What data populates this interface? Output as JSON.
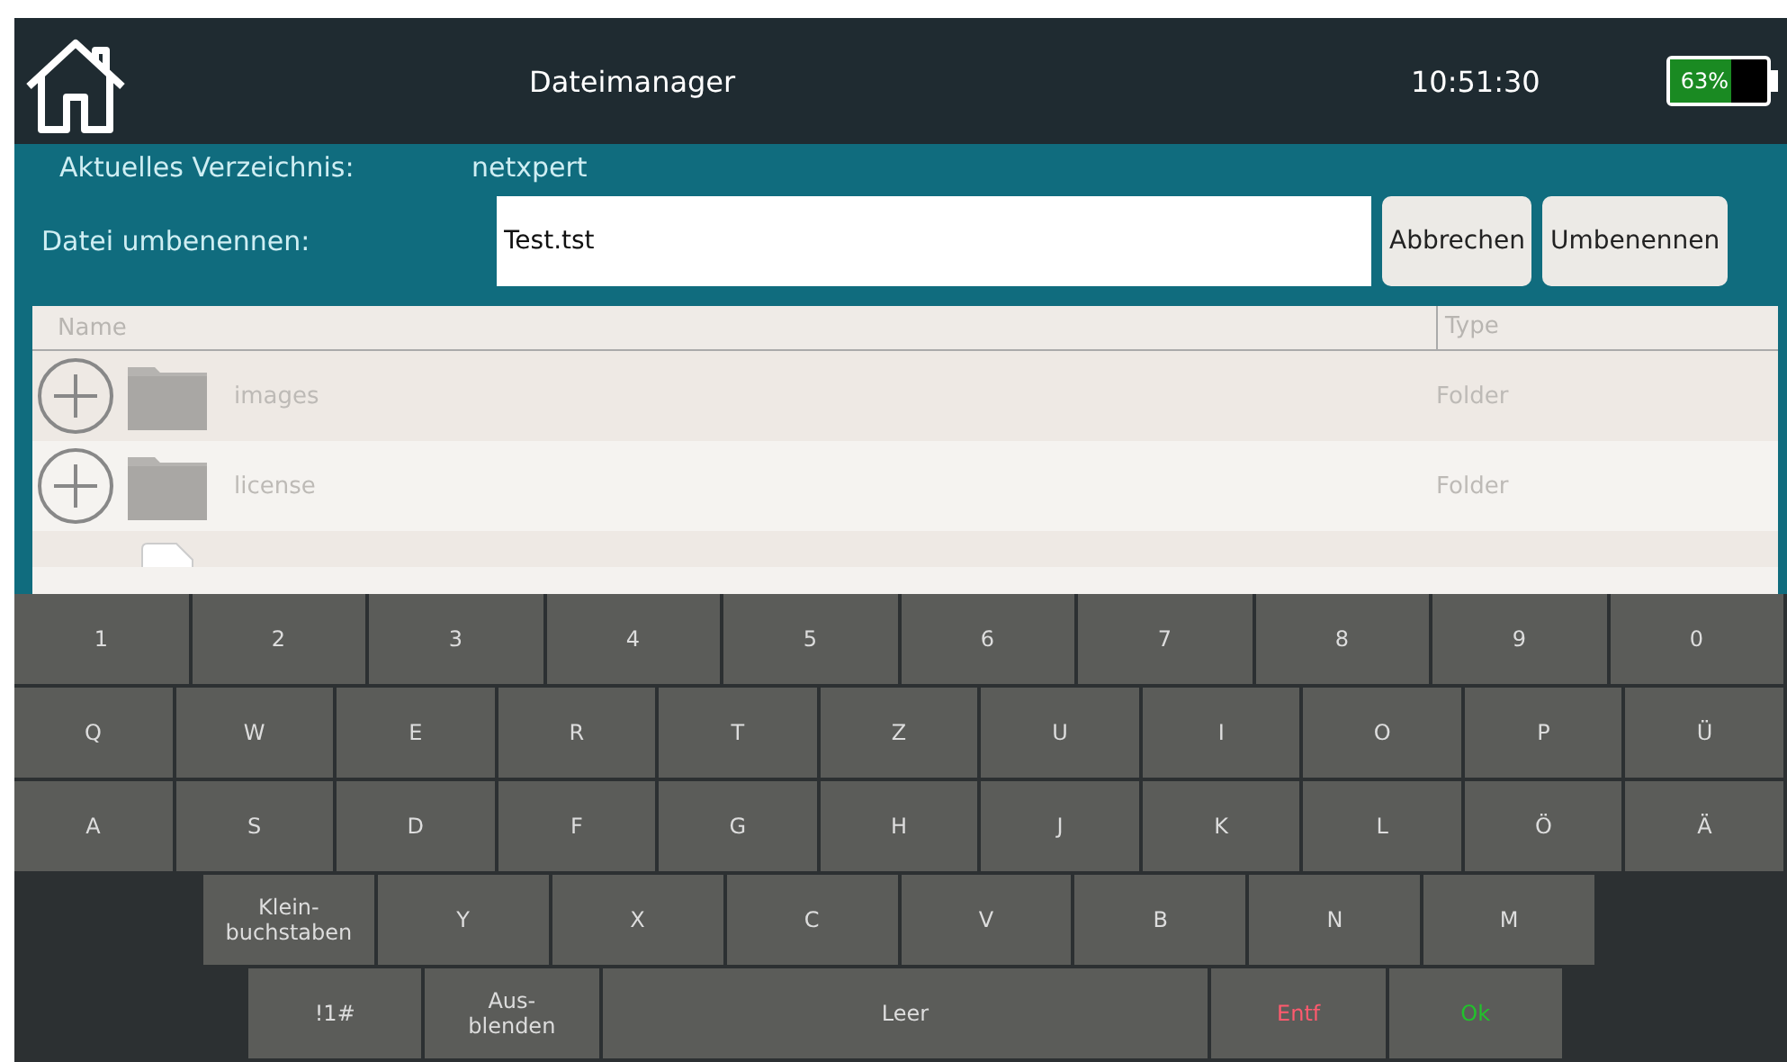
{
  "header": {
    "title": "Dateimanager",
    "time": "10:51:30",
    "battery": {
      "level": 0.63,
      "label": "63%"
    }
  },
  "current_directory": {
    "label": "Aktuelles Verzeichnis:",
    "value": "netxpert"
  },
  "rename": {
    "label": "Datei umbenennen:",
    "value": "Test.tst",
    "buttons": [
      "Abbrechen",
      "Umbenennen"
    ]
  },
  "table": {
    "columns": [
      "Name",
      "Type"
    ],
    "rows": [
      {
        "kind": "folder",
        "name": "images",
        "type": "Folder",
        "expanded": false
      },
      {
        "kind": "folder",
        "name": "license",
        "type": "Folder",
        "expanded": false
      },
      {
        "kind": "file"
      }
    ]
  },
  "keyboard": {
    "rows": [
      {
        "keys": [
          {
            "label": "1",
            "kind": "normal"
          },
          {
            "label": "2",
            "kind": "normal"
          },
          {
            "label": "3",
            "kind": "normal"
          },
          {
            "label": "4",
            "kind": "normal"
          },
          {
            "label": "5",
            "kind": "normal"
          },
          {
            "label": "6",
            "kind": "normal"
          },
          {
            "label": "7",
            "kind": "normal"
          },
          {
            "label": "8",
            "kind": "normal"
          },
          {
            "label": "9",
            "kind": "normal"
          },
          {
            "label": "0",
            "kind": "normal"
          }
        ]
      },
      {
        "keys": [
          {
            "label": "Q",
            "kind": "normal"
          },
          {
            "label": "W",
            "kind": "normal"
          },
          {
            "label": "E",
            "kind": "normal"
          },
          {
            "label": "R",
            "kind": "normal"
          },
          {
            "label": "T",
            "kind": "normal"
          },
          {
            "label": "Z",
            "kind": "normal"
          },
          {
            "label": "U",
            "kind": "normal"
          },
          {
            "label": "I",
            "kind": "normal"
          },
          {
            "label": "O",
            "kind": "normal"
          },
          {
            "label": "P",
            "kind": "normal"
          },
          {
            "label": "Ü",
            "kind": "normal"
          }
        ]
      },
      {
        "keys": [
          {
            "label": "A",
            "kind": "normal"
          },
          {
            "label": "S",
            "kind": "normal"
          },
          {
            "label": "D",
            "kind": "normal"
          },
          {
            "label": "F",
            "kind": "normal"
          },
          {
            "label": "G",
            "kind": "normal"
          },
          {
            "label": "H",
            "kind": "normal"
          },
          {
            "label": "J",
            "kind": "normal"
          },
          {
            "label": "K",
            "kind": "normal"
          },
          {
            "label": "L",
            "kind": "normal"
          },
          {
            "label": "Ö",
            "kind": "normal"
          },
          {
            "label": "Ä",
            "kind": "normal"
          }
        ]
      },
      {
        "keys": [
          {
            "label": "Klein-\nbuchstaben",
            "kind": "normal"
          },
          {
            "label": "Y",
            "kind": "normal"
          },
          {
            "label": "X",
            "kind": "normal"
          },
          {
            "label": "C",
            "kind": "normal"
          },
          {
            "label": "V",
            "kind": "normal"
          },
          {
            "label": "B",
            "kind": "normal"
          },
          {
            "label": "N",
            "kind": "normal"
          },
          {
            "label": "M",
            "kind": "normal"
          }
        ]
      },
      {
        "keys": [
          {
            "label": "!1#",
            "kind": "normal"
          },
          {
            "label": "Aus-\nblenden",
            "kind": "normal"
          },
          {
            "label": "Leer",
            "kind": "space"
          },
          {
            "label": "Entf",
            "kind": "delete"
          },
          {
            "label": "Ok",
            "kind": "confirm"
          }
        ]
      }
    ]
  }
}
